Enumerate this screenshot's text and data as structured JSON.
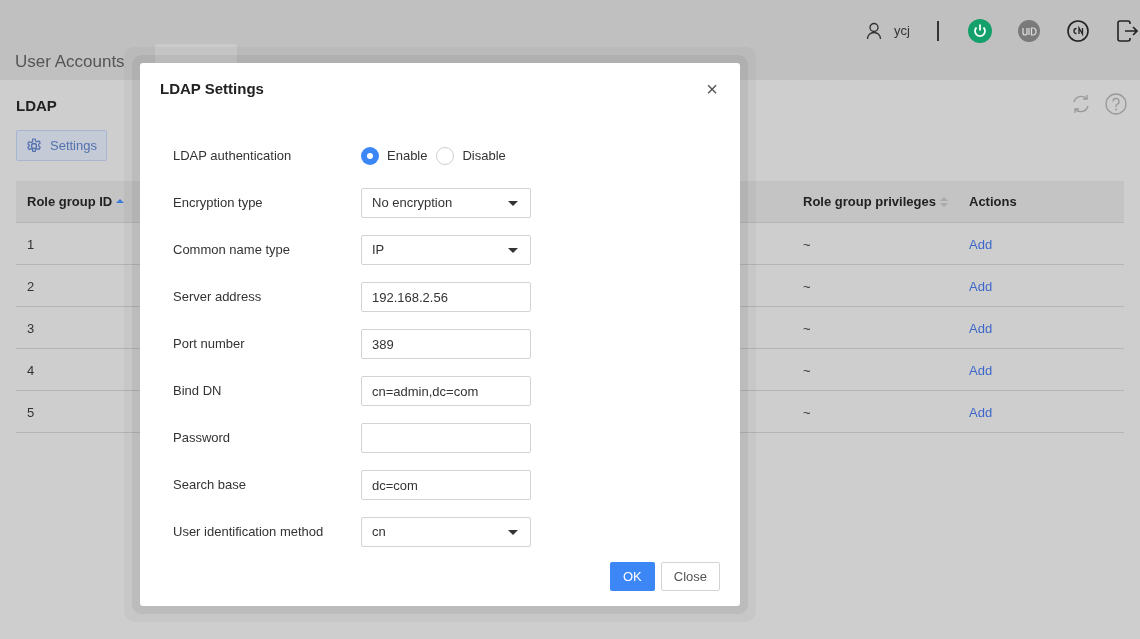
{
  "header": {
    "user": "ycj"
  },
  "tabs": [
    {
      "label": "User Accounts",
      "selected": false
    }
  ],
  "page": {
    "title": "LDAP",
    "settings_button": "Settings"
  },
  "table": {
    "columns": [
      {
        "label": "Role group ID",
        "sortable": true,
        "sorted_ascending": true
      },
      {
        "label": "Role group privileges",
        "sortable": true,
        "sorted_ascending": false
      },
      {
        "label": "Actions"
      }
    ],
    "rows": [
      {
        "id": "1",
        "privileges": "~",
        "action": "Add"
      },
      {
        "id": "2",
        "privileges": "~",
        "action": "Add"
      },
      {
        "id": "3",
        "privileges": "~",
        "action": "Add"
      },
      {
        "id": "4",
        "privileges": "~",
        "action": "Add"
      },
      {
        "id": "5",
        "privileges": "~",
        "action": "Add"
      }
    ]
  },
  "dialog": {
    "title": "LDAP Settings",
    "close": "×",
    "fields": [
      {
        "kind": "radio",
        "label": "LDAP authentication",
        "options": [
          {
            "label": "Enable",
            "selected": true
          },
          {
            "label": "Disable",
            "selected": false
          }
        ]
      },
      {
        "kind": "select",
        "label": "Encryption type",
        "value": "No encryption"
      },
      {
        "kind": "select",
        "label": "Common name type",
        "value": "IP"
      },
      {
        "kind": "text",
        "label": "Server address",
        "value": "192.168.2.56"
      },
      {
        "kind": "text",
        "label": "Port number",
        "value": "389"
      },
      {
        "kind": "text",
        "label": "Bind DN",
        "value": "cn=admin,dc=com"
      },
      {
        "kind": "text",
        "label": "Password"
      },
      {
        "kind": "text",
        "label": "Search base",
        "value": "dc=com"
      },
      {
        "kind": "select",
        "label": "User identification method",
        "value": "cn"
      }
    ],
    "buttons": [
      {
        "label": "OK",
        "kind": "primary"
      },
      {
        "label": "Close",
        "kind": "default"
      }
    ]
  }
}
